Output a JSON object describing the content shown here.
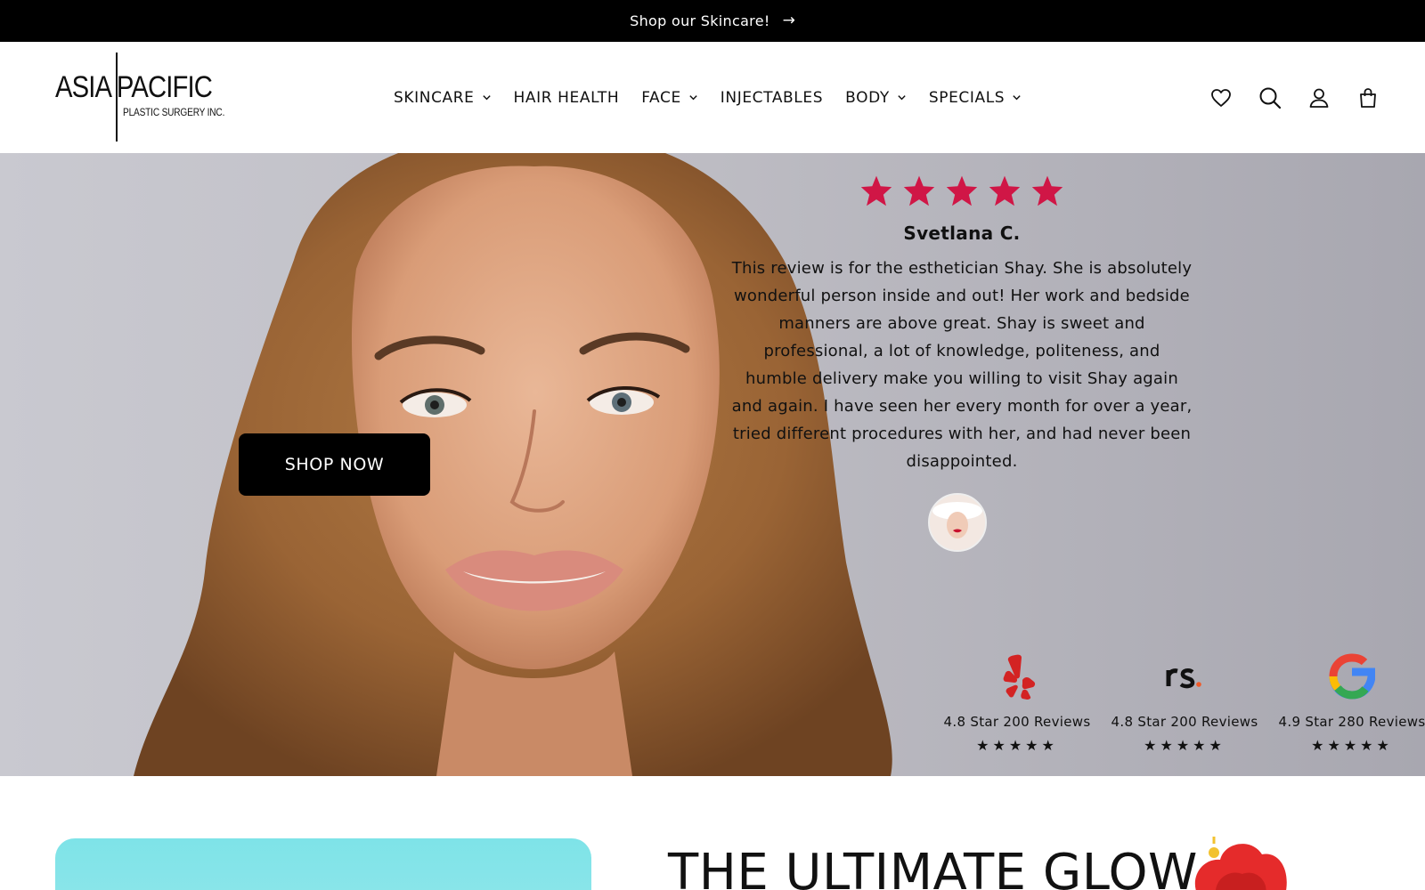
{
  "announcement": {
    "text": "Shop our Skincare!",
    "arrow": "→"
  },
  "logo": {
    "main": "ASIA PACIFIC",
    "sub": "PLASTIC SURGERY INC."
  },
  "nav": [
    {
      "label": "SKINCARE",
      "dropdown": true
    },
    {
      "label": "HAIR HEALTH",
      "dropdown": false
    },
    {
      "label": "FACE",
      "dropdown": true
    },
    {
      "label": "INJECTABLES",
      "dropdown": false
    },
    {
      "label": "BODY",
      "dropdown": true
    },
    {
      "label": "SPECIALS",
      "dropdown": true
    }
  ],
  "header_icons": [
    "heart-icon",
    "search-icon",
    "account-icon",
    "cart-icon"
  ],
  "hero": {
    "cta_label": "SHOP NOW",
    "review": {
      "rating": 5,
      "star_color": "#d01646",
      "reviewer": "Svetlana C.",
      "text": "This review is for the esthetician Shay. She is absolutely wonderful person inside and out! Her work and bedside manners are above great. Shay is sweet and professional, a lot of knowledge, politeness, and humble delivery make you willing to visit Shay again and again. I have seen her every month for over a year, tried different procedures with her, and had never been disappointed."
    },
    "ratings": [
      {
        "icon": "yelp-icon",
        "text": "4.8 Star 200 Reviews",
        "stars": "★★★★★"
      },
      {
        "icon": "realself-icon",
        "text": "4.8 Star 200 Reviews",
        "stars": "★★★★★"
      },
      {
        "icon": "google-icon",
        "text": "4.9 Star 280 Reviews",
        "stars": "★★★★★"
      }
    ]
  },
  "section": {
    "title": "THE ULTIMATE GLOW"
  },
  "colors": {
    "announcement_bg": "#000000",
    "accent_star": "#d01646",
    "promo_card": "#84e4e9"
  }
}
